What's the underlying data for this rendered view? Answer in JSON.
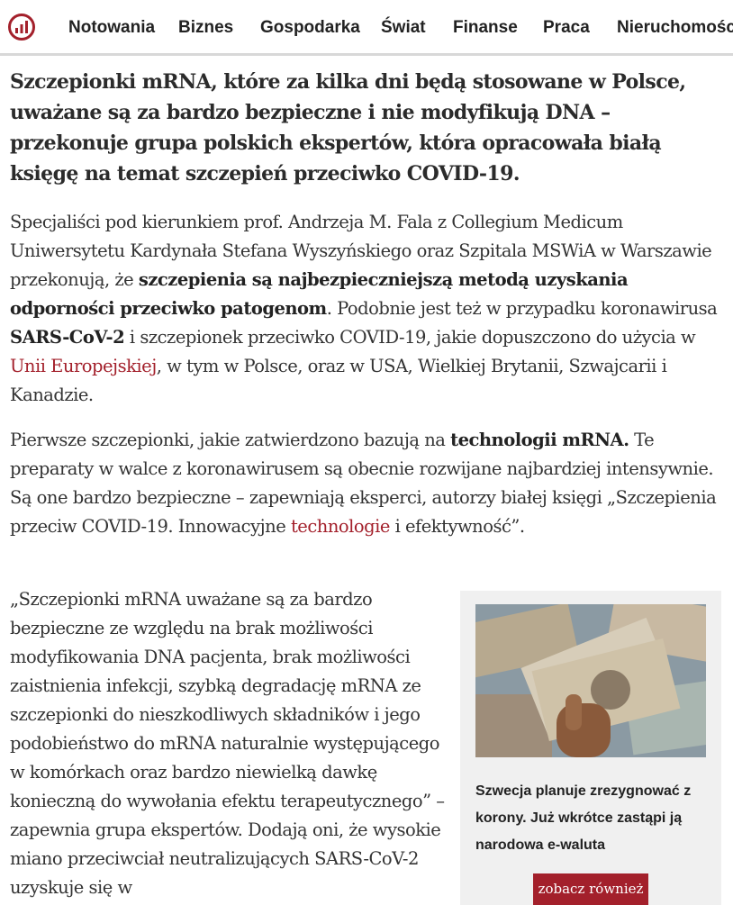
{
  "header": {
    "logo_icon": "chart-bars-icon",
    "nav": [
      {
        "label": "Notowania"
      },
      {
        "label": "Biznes"
      },
      {
        "label": "Gospodarka"
      },
      {
        "label": "Świat"
      },
      {
        "label": "Finanse"
      },
      {
        "label": "Praca"
      },
      {
        "label": "Nieruchomości"
      }
    ]
  },
  "article": {
    "lead": "Szczepionki mRNA, które za kilka dni będą stosowane w Polsce, uważane są za bardzo bezpieczne i nie modyfikują DNA – przekonuje grupa polskich ekspertów, która opracowała białą księgę na temat szczepień przeciwko COVID-19.",
    "p1": {
      "t1": "Specjaliści pod kierunkiem prof. Andrzeja M. Fala z Collegium Medicum Uniwersytetu Kardynała Stefana Wyszyńskiego oraz Szpitala MSWiA w Warszawie przekonują, że ",
      "b1": "szczepienia są najbezpieczniejszą metodą uzyskania odporności przeciwko patogenom",
      "t2": ". Podobnie jest też w przypadku koronawirusa ",
      "b2": "SARS-CoV-2",
      "t3": " i szczepionek przeciwko COVID-19, jakie dopuszczono do użycia w ",
      "link": "Unii Europejskiej",
      "t4": ", w tym w Polsce, oraz w USA, Wielkiej Brytanii, Szwajcarii i Kanadzie."
    },
    "p2": {
      "t1": "Pierwsze szczepionki, jakie zatwierdzono bazują na ",
      "b1": "technologii mRNA.",
      "t2": " Te preparaty w walce z koronawirusem są obecnie rozwijane najbardziej intensywnie. Są one bardzo bezpieczne – zapewniają eksperci, autorzy białej księgi „Szczepienia przeciw COVID-19. Innowacyjne ",
      "link": "technologie",
      "t3": " i efektywność”."
    },
    "p3": "„Szczepionki mRNA uważane są za bardzo bezpieczne ze względu na brak możliwości modyfikowania DNA pacjenta, brak możliwości zaistnienia infekcji, szybką degradację mRNA ze szczepionki do nieszkodliwych składników i jego podobieństwo do mRNA naturalnie występującego w komórkach oraz bardzo niewielką dawkę konieczną do wywołania efektu terapeutycznego” – zapewnia grupa ekspertów. Dodają oni, że wysokie miano przeciwciał neutralizujących SARS-CoV-2 uzyskuje się w"
  },
  "sidebar": {
    "card_title": "Szwecja planuje zrezygnować z korony. Już wkrótce zastąpi ją narodowa e-waluta",
    "button_label": "zobacz również"
  }
}
